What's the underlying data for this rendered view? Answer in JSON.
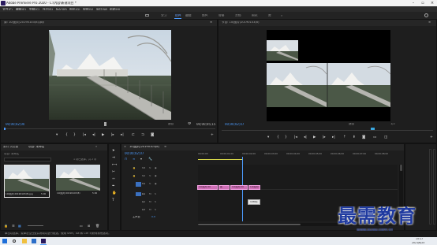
{
  "app": {
    "title": "Adobe Premiere Pro 2020 - C:\\内容\\新建项目 *"
  },
  "menu": [
    "文件(F)",
    "编辑(E)",
    "剪辑(C)",
    "序列(S)",
    "标记(M)",
    "图形(G)",
    "视图(V)",
    "窗口(W)",
    "帮助(H)"
  ],
  "workspaces": {
    "items": [
      "学习",
      "组件",
      "编辑",
      "颜色",
      "效果",
      "音频",
      "图形",
      "库"
    ],
    "active": "组件"
  },
  "source_monitor": {
    "tab": "源: 10(图片)20190103(8).jpg",
    "timecode_in": "00;00;02;00",
    "timecode_out": "00;00;05;15",
    "zoom": "适合"
  },
  "program_monitor": {
    "tab": "节目: 10(图片)20190103(8)",
    "timecode": "00;00;02;07",
    "zoom": "适合",
    "fraction": "1/2"
  },
  "project_panel": {
    "tabs": [
      "素材 浏览器",
      "项目: 未命名",
      "媒体"
    ],
    "project_name": "项目: 未命名",
    "search_placeholder": "",
    "item_count": "1 项已选择，共 2 项",
    "items": [
      {
        "name": "10(图片)20190103(8).jpg",
        "duration": "5:00"
      },
      {
        "name": "10(图片)20190103(8)",
        "duration": "5:00"
      }
    ]
  },
  "timeline": {
    "tab": "10(图片)20190103(8)",
    "timecode": "00;00;02;07",
    "ruler": [
      "00;00;00",
      "00;00;01;00",
      "00;00;02;00",
      "00;00;03;00",
      "00;00;04;00",
      "00;00;05;00",
      "00;00;06;00",
      "00;00;07;00",
      "00;00;08;00"
    ],
    "tracks_video": [
      "V3",
      "V2",
      "V1"
    ],
    "tracks_audio": [
      "A1",
      "A2",
      "A3"
    ],
    "master": "主声道",
    "master_value": "0.0",
    "clips": [
      "10(图片)20",
      "图",
      "10(图片)20",
      "10(图片)20"
    ],
    "tooltip": "1080p"
  },
  "status": {
    "text": "单击以选择，或单击空白处并拖动以进行框选。使用 Shift、Alt 和 Ctrl 可获得其他选项。"
  },
  "taskbar": {
    "time": "15:17",
    "date": "2021/6/24"
  },
  "watermark": {
    "text": "最需教育",
    "url": "www.zuixu.com.cn"
  },
  "colors": {
    "accent": "#4d9cff",
    "clip": "#cf6fb6",
    "watermark": "#1f3aa0"
  }
}
